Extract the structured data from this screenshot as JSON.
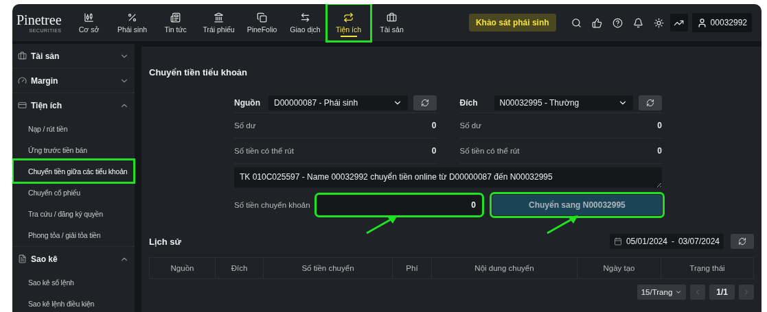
{
  "logo": {
    "name": "Pinetree",
    "tagline": "SECURITIES"
  },
  "nav": [
    {
      "label": "Cơ sở",
      "selected": false,
      "highlighted": false
    },
    {
      "label": "Phái sinh",
      "selected": false,
      "highlighted": false
    },
    {
      "label": "Tin tức",
      "selected": false,
      "highlighted": false
    },
    {
      "label": "Trái phiếu",
      "selected": false,
      "highlighted": false
    },
    {
      "label": "PineFolio",
      "selected": false,
      "highlighted": false
    },
    {
      "label": "Giao dịch",
      "selected": false,
      "highlighted": false
    },
    {
      "label": "Tiện ích",
      "selected": true,
      "highlighted": true
    },
    {
      "label": "Tài sản",
      "selected": false,
      "highlighted": false
    }
  ],
  "survey_button": "Khảo sát phái sinh",
  "account": "00032992",
  "sidebar": [
    {
      "label": "Tài sản",
      "expanded": false
    },
    {
      "label": "Margin",
      "expanded": false
    },
    {
      "label": "Tiện ích",
      "expanded": true,
      "children": [
        {
          "label": "Nạp / rút tiền",
          "selected": false,
          "highlighted": false
        },
        {
          "label": "Ứng trước tiền bán",
          "selected": false,
          "highlighted": false
        },
        {
          "label": "Chuyển tiền giữa các tiểu khoản",
          "selected": true,
          "highlighted": true
        },
        {
          "label": "Chuyển cổ phiếu",
          "selected": false,
          "highlighted": false
        },
        {
          "label": "Tra cứu / đăng ký quyền",
          "selected": false,
          "highlighted": false
        },
        {
          "label": "Phong tỏa / giải tỏa tiền",
          "selected": false,
          "highlighted": false
        }
      ]
    },
    {
      "label": "Sao kê",
      "expanded": true,
      "children": [
        {
          "label": "Sao kê sổ lệnh",
          "selected": false,
          "highlighted": false
        },
        {
          "label": "Sao kê lệnh điều kiện",
          "selected": false,
          "highlighted": false
        }
      ]
    }
  ],
  "transfer": {
    "title": "Chuyển tiền tiểu khoản",
    "accounts": [
      {
        "label": "Nguồn",
        "value": "D00000087 - Phái sinh",
        "rows": [
          {
            "label": "Số dư",
            "value": "0"
          },
          {
            "label": "Số tiền có thể rút",
            "value": "0"
          }
        ]
      },
      {
        "label": "Đích",
        "value": "N00032995 - Thường",
        "rows": [
          {
            "label": "Số dư",
            "value": "0"
          },
          {
            "label": "Số tiền có thể rút",
            "value": "0"
          }
        ]
      }
    ],
    "note": "TK 010C025597 - Name 00032992 chuyển tiền online từ D00000087 đến N00032995",
    "amount_label": "Số tiền chuyển khoản",
    "amount": "0",
    "amount_highlighted": true,
    "submit": "Chuyển sang N00032995",
    "submit_highlighted": true
  },
  "history": {
    "title": "Lịch sử",
    "date_from": "05/01/2024",
    "date_separator": "-",
    "date_to": "03/07/2024",
    "columns": [
      "Nguồn",
      "Đích",
      "Số tiền chuyển",
      "Phí",
      "Nội dung chuyển",
      "Ngày tạo",
      "Trạng thái"
    ],
    "page_size": "15/Trang",
    "page": "1/1"
  },
  "annotations": [
    {
      "kind": "arrow"
    },
    {
      "kind": "arrow"
    }
  ]
}
